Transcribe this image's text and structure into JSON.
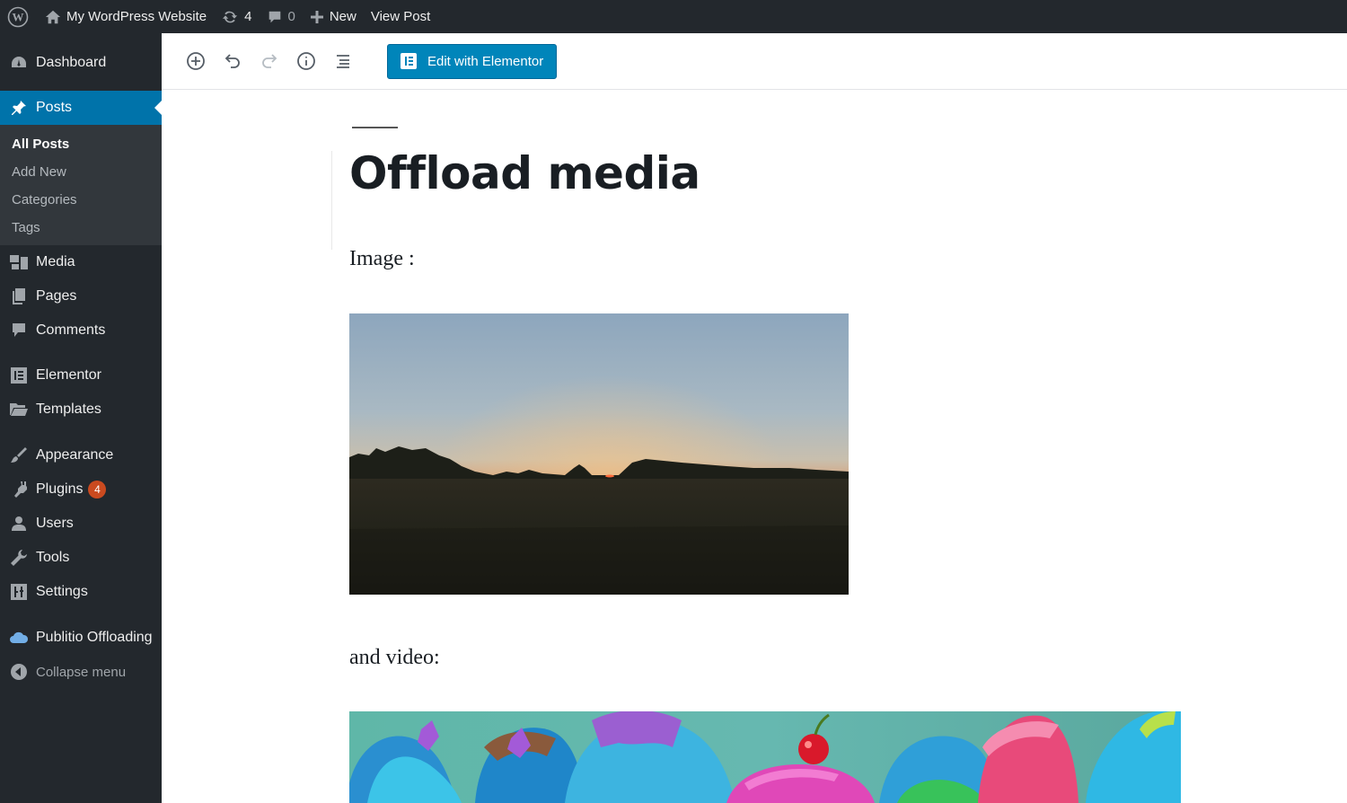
{
  "admin_bar": {
    "site_name": "My WordPress Website",
    "updates_count": "4",
    "comments_count": "0",
    "new_label": "New",
    "view_post_label": "View Post"
  },
  "sidebar": {
    "dashboard": "Dashboard",
    "posts": "Posts",
    "posts_submenu": [
      "All Posts",
      "Add New",
      "Categories",
      "Tags"
    ],
    "media": "Media",
    "pages": "Pages",
    "comments": "Comments",
    "elementor": "Elementor",
    "templates": "Templates",
    "appearance": "Appearance",
    "plugins": "Plugins",
    "plugins_badge": "4",
    "users": "Users",
    "tools": "Tools",
    "settings": "Settings",
    "publitio": "Publitio Offloading",
    "collapse": "Collapse menu"
  },
  "toolbar": {
    "edit_with_elementor": "Edit with Elementor"
  },
  "post": {
    "title": "Offload media",
    "paragraph_image": "Image :",
    "paragraph_video": "and video:"
  },
  "colors": {
    "admin_dark": "#23282d",
    "admin_blue": "#0073aa",
    "submenu_bg": "#32373c",
    "badge": "#ca4a1f",
    "button_blue": "#0085ba"
  }
}
